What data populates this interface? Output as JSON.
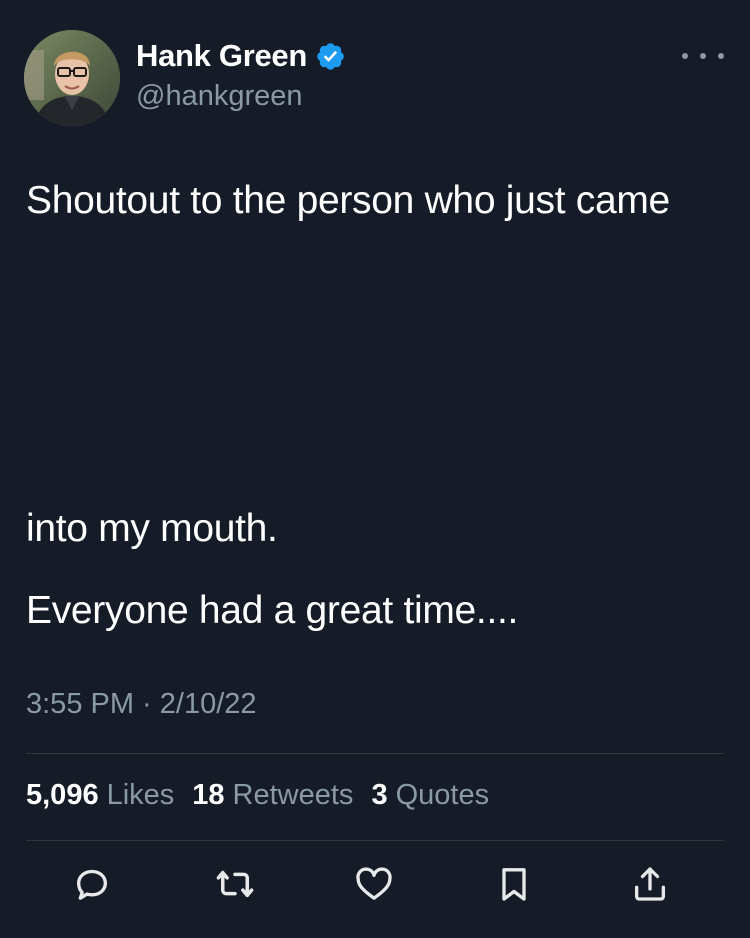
{
  "author": {
    "display_name": "Hank Green",
    "handle": "@hankgreen",
    "verified": true
  },
  "tweet": {
    "text_line1": "Shoutout to the person who just came",
    "text_line2": "into my mouth.",
    "text_line3": "Everyone had a great time....",
    "timestamp": "3:55 PM · 2/10/22"
  },
  "stats": {
    "likes_count": "5,096",
    "likes_label": "Likes",
    "retweets_count": "18",
    "retweets_label": "Retweets",
    "quotes_count": "3",
    "quotes_label": "Quotes"
  },
  "actions": {
    "icons": [
      "reply-icon",
      "retweet-icon",
      "like-icon",
      "bookmark-icon",
      "share-icon"
    ]
  },
  "colors": {
    "background": "#151c28",
    "primary_text": "#ffffff",
    "secondary_text": "#8b98a5",
    "verified_badge": "#1d9bf0"
  }
}
